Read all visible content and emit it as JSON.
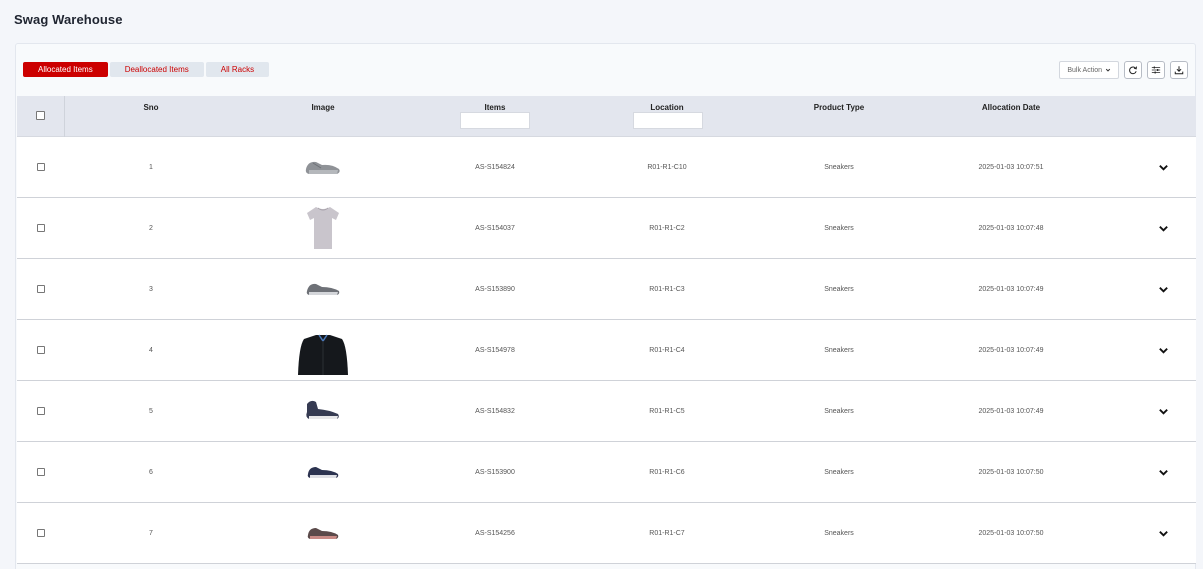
{
  "page": {
    "title": "Swag Warehouse"
  },
  "tabs": [
    {
      "label": "Allocated Items",
      "active": true
    },
    {
      "label": "Deallocated Items",
      "active": false
    },
    {
      "label": "All Racks",
      "active": false
    }
  ],
  "toolbar": {
    "bulk_action_label": "Bulk Action",
    "icons": [
      "refresh-icon",
      "filter-sliders-icon",
      "download-icon"
    ]
  },
  "table": {
    "columns": [
      "Sno",
      "Image",
      "Items",
      "Location",
      "Product Type",
      "Allocation Date"
    ],
    "items_filter_value": "",
    "location_filter_value": "",
    "rows": [
      {
        "sno": "1",
        "image": "gray-sneaker",
        "item": "AS-S154824",
        "location": "R01-R1-C10",
        "type": "Sneakers",
        "date": "2025-01-03 10:07:51"
      },
      {
        "sno": "2",
        "image": "gray-tshirt",
        "item": "AS-S154037",
        "location": "R01-R1-C2",
        "type": "Sneakers",
        "date": "2025-01-03 10:07:48"
      },
      {
        "sno": "3",
        "image": "gray-sneaker",
        "item": "AS-S153890",
        "location": "R01-R1-C3",
        "type": "Sneakers",
        "date": "2025-01-03 10:07:49"
      },
      {
        "sno": "4",
        "image": "black-jacket",
        "item": "AS-S154978",
        "location": "R01-R1-C4",
        "type": "Sneakers",
        "date": "2025-01-03 10:07:49"
      },
      {
        "sno": "5",
        "image": "navy-high-sneaker",
        "item": "AS-S154832",
        "location": "R01-R1-C5",
        "type": "Sneakers",
        "date": "2025-01-03 10:07:49"
      },
      {
        "sno": "6",
        "image": "navy-sneaker",
        "item": "AS-S153900",
        "location": "R01-R1-C6",
        "type": "Sneakers",
        "date": "2025-01-03 10:07:50"
      },
      {
        "sno": "7",
        "image": "brown-sneaker",
        "item": "AS-S154256",
        "location": "R01-R1-C7",
        "type": "Sneakers",
        "date": "2025-01-03 10:07:50"
      }
    ]
  },
  "colors": {
    "accent": "#cc0000",
    "header_bg": "#e3e6ee",
    "tab_inactive_bg": "#e1e7ee"
  }
}
